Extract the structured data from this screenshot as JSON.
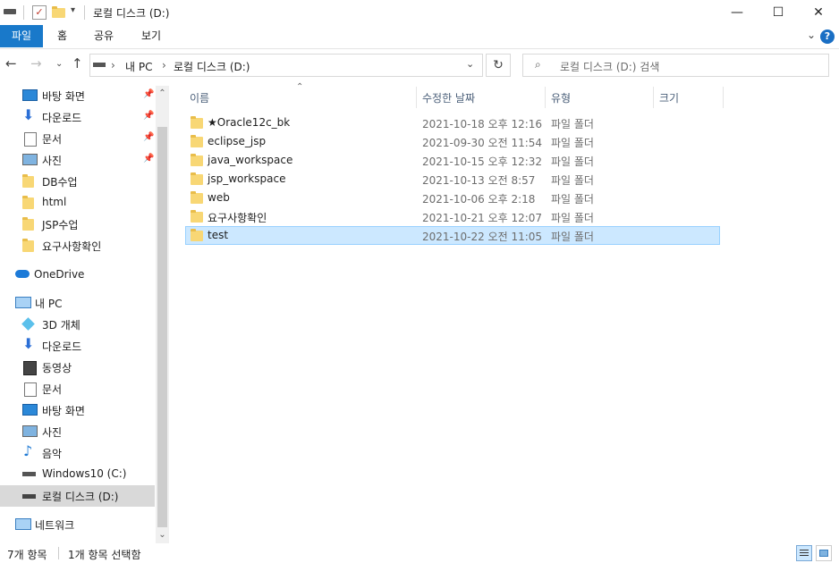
{
  "window": {
    "title": "로컬 디스크 (D:)",
    "controls": [
      "—",
      "☐",
      "✕"
    ]
  },
  "ribbon": {
    "tabs": [
      "파일",
      "홈",
      "공유",
      "보기"
    ],
    "help": "?"
  },
  "address": {
    "crumbs": [
      "내 PC",
      "로컬 디스크 (D:)"
    ],
    "search_placeholder": "로컬 디스크 (D:) 검색"
  },
  "nav": {
    "quick": [
      {
        "label": "바탕 화면",
        "icon": "desktop-icon"
      },
      {
        "label": "다운로드",
        "icon": "download-icon"
      },
      {
        "label": "문서",
        "icon": "document-icon"
      },
      {
        "label": "사진",
        "icon": "pictures-icon"
      },
      {
        "label": "DB수업",
        "icon": "folder-icon"
      },
      {
        "label": "html",
        "icon": "folder-icon"
      },
      {
        "label": "JSP수업",
        "icon": "folder-icon"
      },
      {
        "label": "요구사항확인",
        "icon": "folder-icon"
      }
    ],
    "onedrive": "OneDrive",
    "pc": "내 PC",
    "pc_items": [
      {
        "label": "3D 개체",
        "icon": "3d-objects-icon"
      },
      {
        "label": "다운로드",
        "icon": "download-icon"
      },
      {
        "label": "동영상",
        "icon": "video-icon"
      },
      {
        "label": "문서",
        "icon": "document-icon"
      },
      {
        "label": "바탕 화면",
        "icon": "desktop-icon"
      },
      {
        "label": "사진",
        "icon": "pictures-icon"
      },
      {
        "label": "음악",
        "icon": "music-icon"
      },
      {
        "label": "Windows10 (C:)",
        "icon": "drive-icon"
      },
      {
        "label": "로컬 디스크 (D:)",
        "icon": "drive-icon"
      }
    ],
    "network": "네트워크"
  },
  "columns": {
    "name": "이름",
    "date": "수정한 날짜",
    "type": "유형",
    "size": "크기"
  },
  "files": [
    {
      "name": "★Oracle12c_bk",
      "date": "2021-10-18 오후 12:16",
      "type": "파일 폴더"
    },
    {
      "name": "eclipse_jsp",
      "date": "2021-09-30 오전 11:54",
      "type": "파일 폴더"
    },
    {
      "name": "java_workspace",
      "date": "2021-10-15 오후 12:32",
      "type": "파일 폴더"
    },
    {
      "name": "jsp_workspace",
      "date": "2021-10-13 오전 8:57",
      "type": "파일 폴더"
    },
    {
      "name": "web",
      "date": "2021-10-06 오후 2:18",
      "type": "파일 폴더"
    },
    {
      "name": "요구사항확인",
      "date": "2021-10-21 오후 12:07",
      "type": "파일 폴더"
    },
    {
      "name": "test",
      "date": "2021-10-22 오전 11:05",
      "type": "파일 폴더"
    }
  ],
  "status": {
    "count": "7개 항목",
    "selected": "1개 항목 선택함"
  },
  "colors": {
    "accent": "#1979ca",
    "selection": "#cce8ff"
  }
}
